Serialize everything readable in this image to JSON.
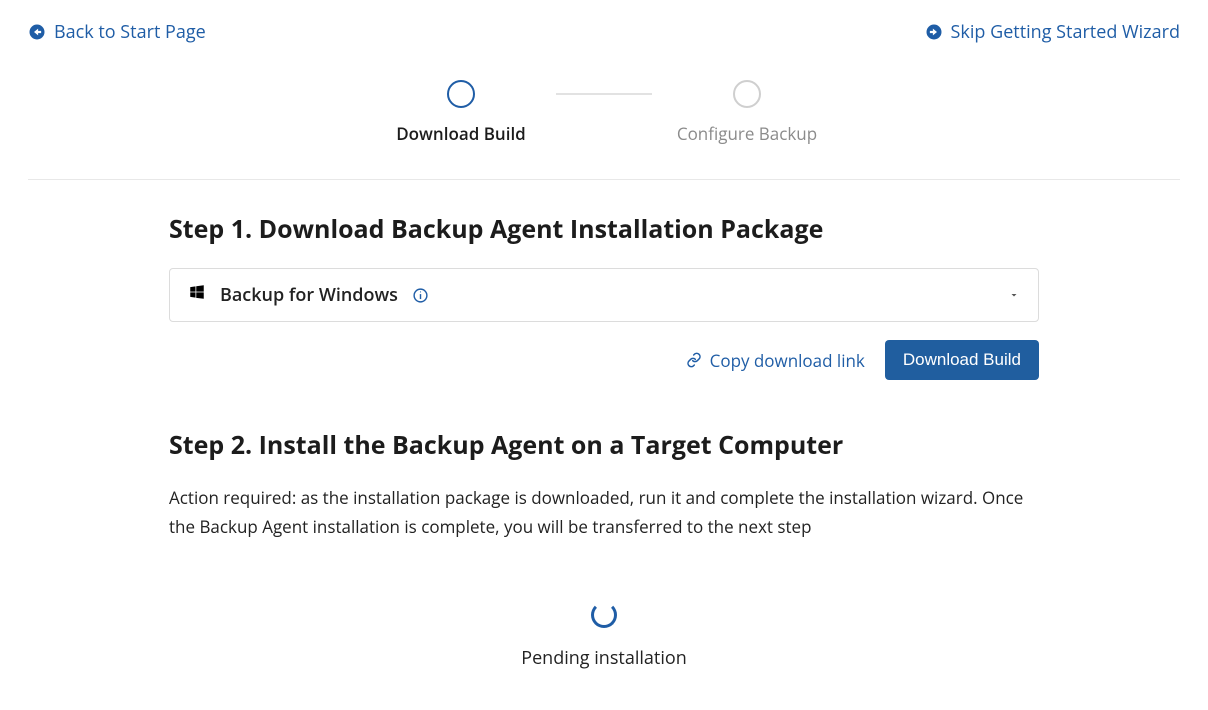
{
  "nav": {
    "back_label": "Back to Start Page",
    "skip_label": "Skip Getting Started Wizard"
  },
  "stepper": {
    "steps": [
      {
        "label": "Download Build",
        "active": true
      },
      {
        "label": "Configure Backup",
        "active": false
      }
    ]
  },
  "step1": {
    "heading": "Step 1. Download Backup Agent Installation Package",
    "product_label": "Backup for Windows",
    "copy_link_label": "Copy download link",
    "download_button_label": "Download Build"
  },
  "step2": {
    "heading": "Step 2. Install the Backup Agent on a Target Computer",
    "description": "Action required: as the installation package is downloaded, run it and complete the installation wizard. Once the Backup Agent installation is complete, you will be transferred to the next step",
    "pending_label": "Pending installation"
  }
}
